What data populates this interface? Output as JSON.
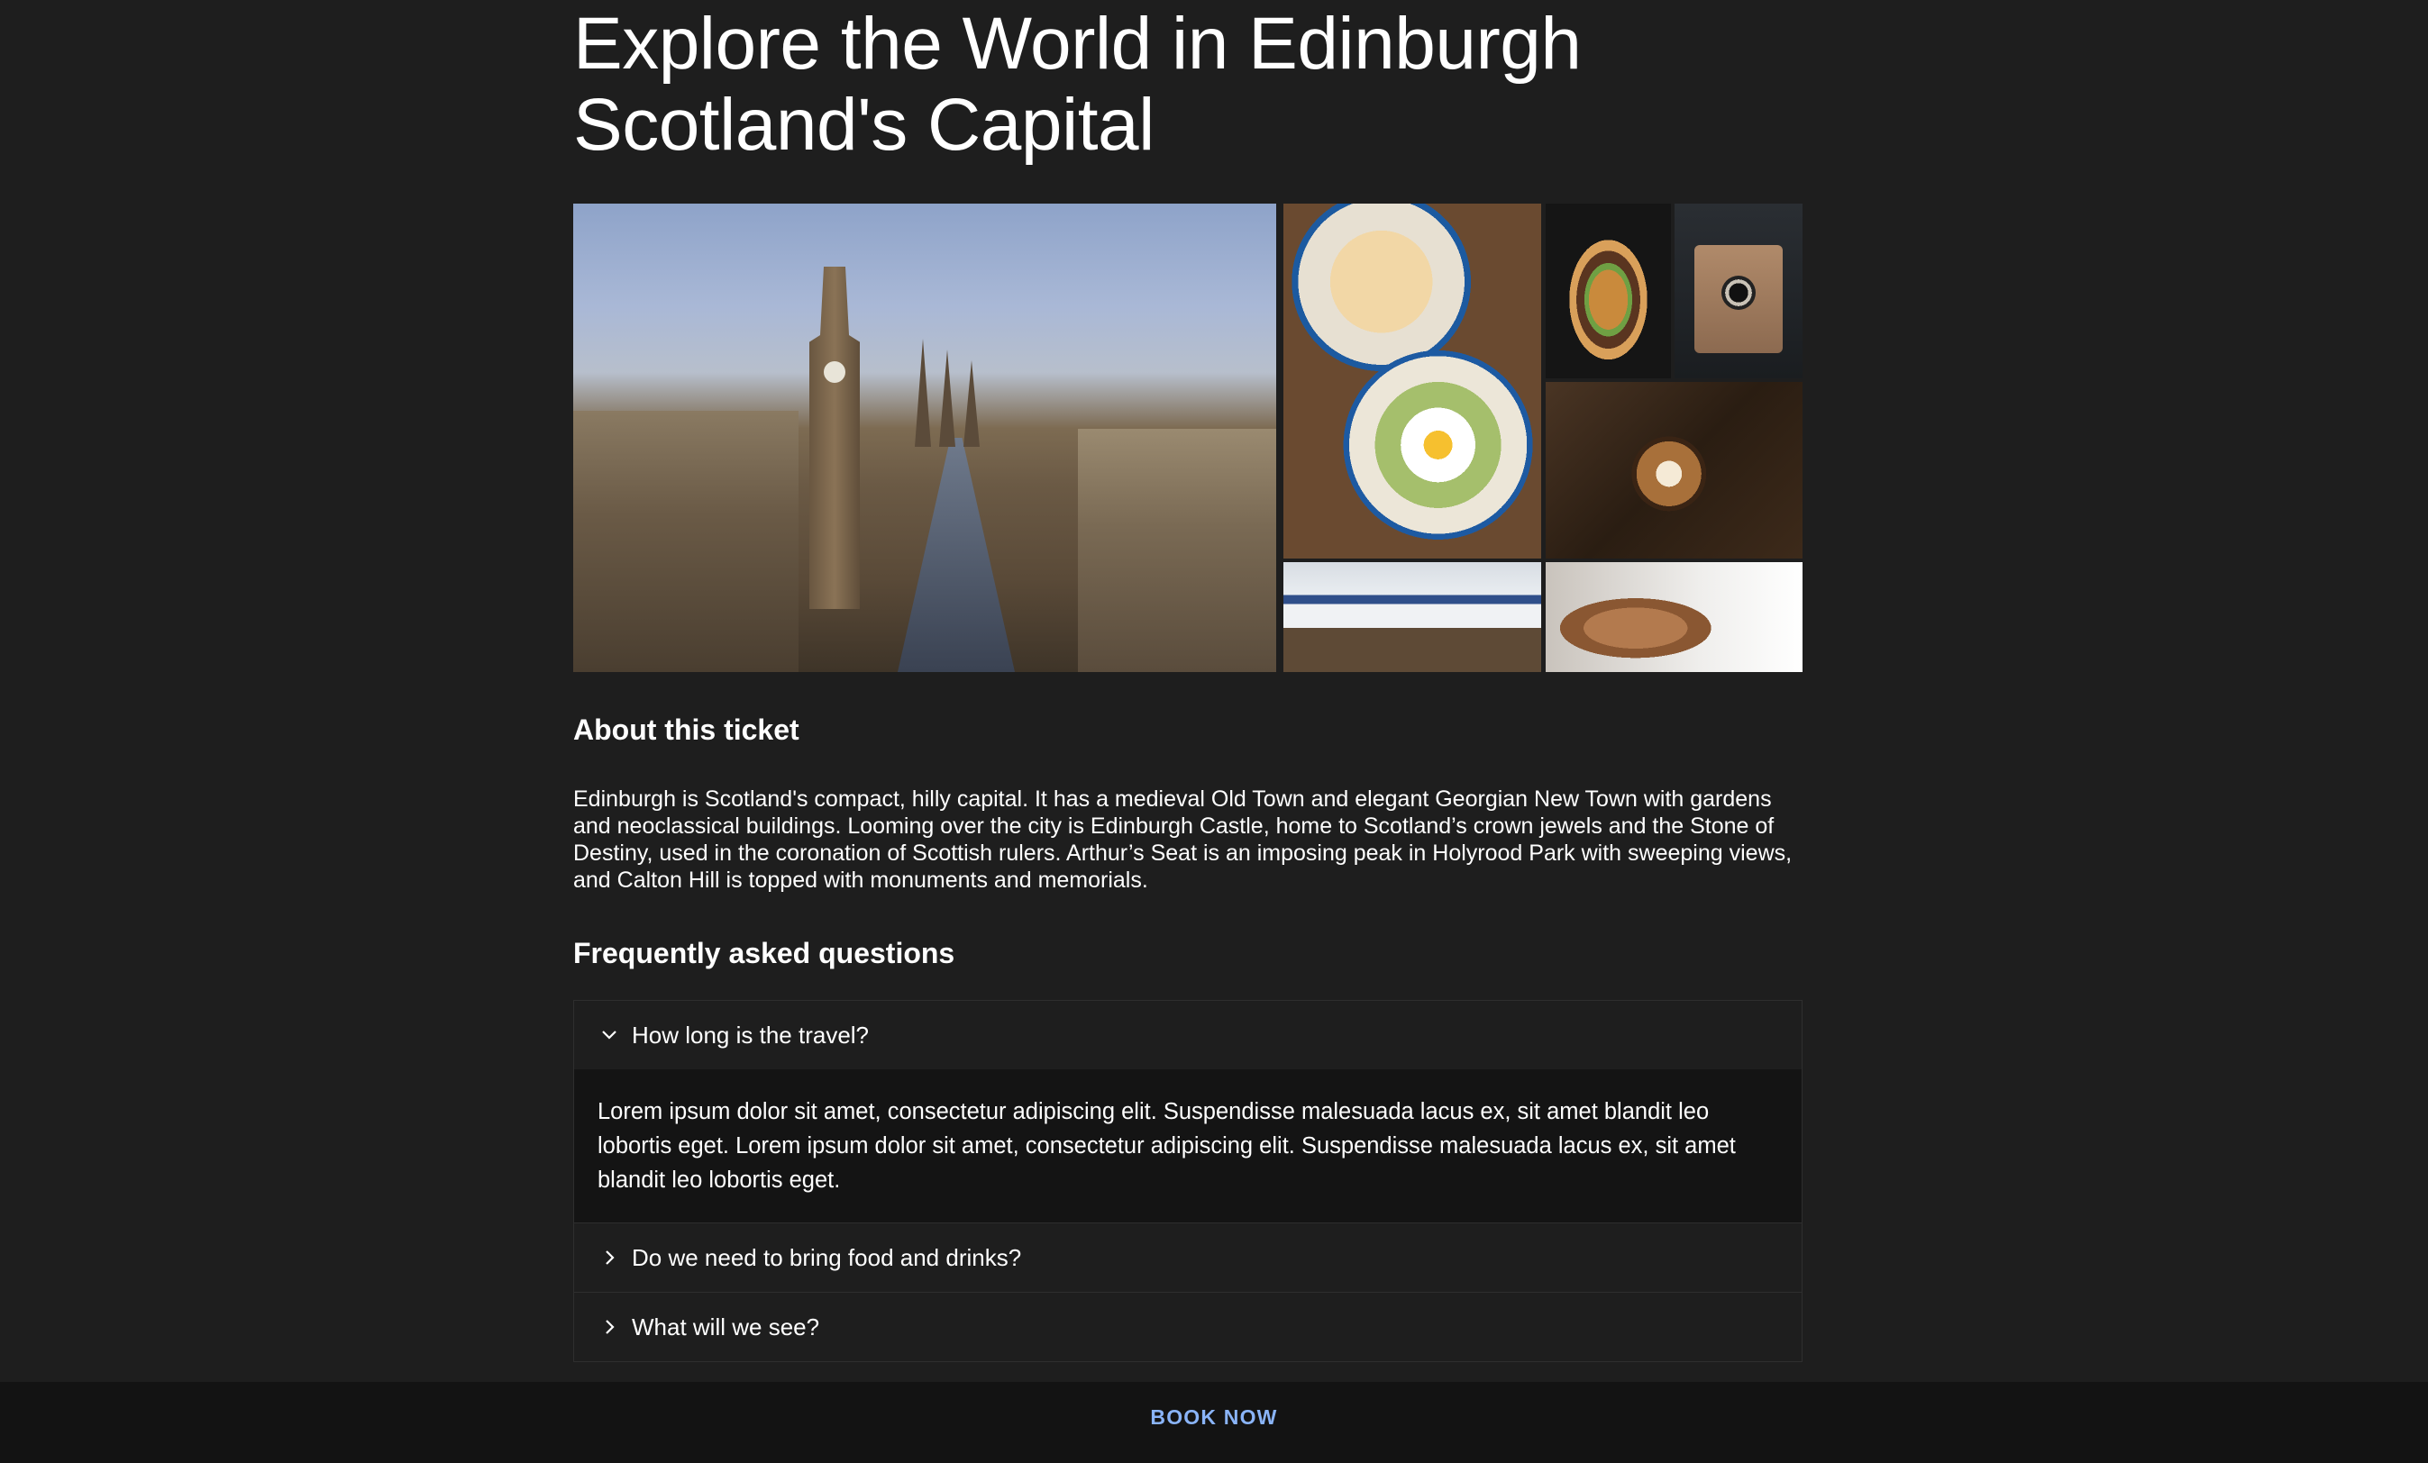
{
  "header": {
    "title_line1": "Explore the World in Edinburgh",
    "title_line2": "Scotland's Capital"
  },
  "about": {
    "heading": "About this ticket",
    "text": "Edinburgh is Scotland's compact, hilly capital. It has a medieval Old Town and elegant Georgian New Town with gardens and neoclassical buildings. Looming over the city is Edinburgh Castle, home to Scotland’s crown jewels and the Stone of Destiny, used in the coronation of Scottish rulers. Arthur’s Seat is an imposing peak in Holyrood Park with sweeping views, and Calton Hill is topped with monuments and memorials."
  },
  "faq": {
    "heading": "Frequently asked questions",
    "items": [
      {
        "question": "How long is the travel?",
        "expanded": true,
        "answer": "Lorem ipsum dolor sit amet, consectetur adipiscing elit. Suspendisse malesuada lacus ex, sit amet blandit leo lobortis eget. Lorem ipsum dolor sit amet, consectetur adipiscing elit. Suspendisse malesuada lacus ex, sit amet blandit leo lobortis eget."
      },
      {
        "question": "Do we need to bring food and drinks?",
        "expanded": false
      },
      {
        "question": "What will we see?",
        "expanded": false
      }
    ]
  },
  "footer": {
    "book_label": "BOOK NOW"
  },
  "colors": {
    "background": "#1e1e1e",
    "footer": "#131313",
    "accent": "#8ab4f8"
  }
}
